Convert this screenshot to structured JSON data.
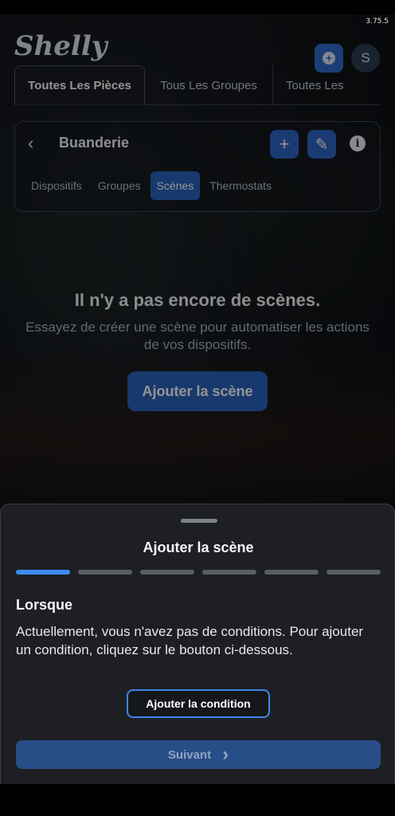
{
  "status": {
    "version": "3.75.5"
  },
  "header": {
    "logo": "Shelly",
    "avatar_letter": "S"
  },
  "tabs": [
    {
      "label": "Toutes Les Pièces"
    },
    {
      "label": "Tous Les Groupes"
    },
    {
      "label": "Toutes Les"
    }
  ],
  "room": {
    "back": "‹",
    "title": "Buanderie",
    "add": "+",
    "edit": "✎",
    "info": "i",
    "subtabs": [
      {
        "label": "Dispositifs"
      },
      {
        "label": "Groupes"
      },
      {
        "label": "Scènes"
      },
      {
        "label": "Thermostats"
      }
    ]
  },
  "empty_state": {
    "title": "Il n'y a pas encore de scènes.",
    "text": "Essayez de créer une scène pour automatiser les actions de vos dispositifs.",
    "button": "Ajouter la scène"
  },
  "sheet": {
    "title": "Ajouter la scène",
    "steps_total": 6,
    "step_current": 1,
    "section_title": "Lorsque",
    "section_text": "Actuellement, vous n'avez pas de conditions. Pour ajouter un condition, cliquez sur le bouton ci-dessous.",
    "add_condition": "Ajouter la condition",
    "next": "Suivant",
    "next_arrow": "›"
  },
  "colors": {
    "accent": "#3d8bf0",
    "button": "#2a63bd",
    "sheet_bg": "#1d1f23"
  }
}
